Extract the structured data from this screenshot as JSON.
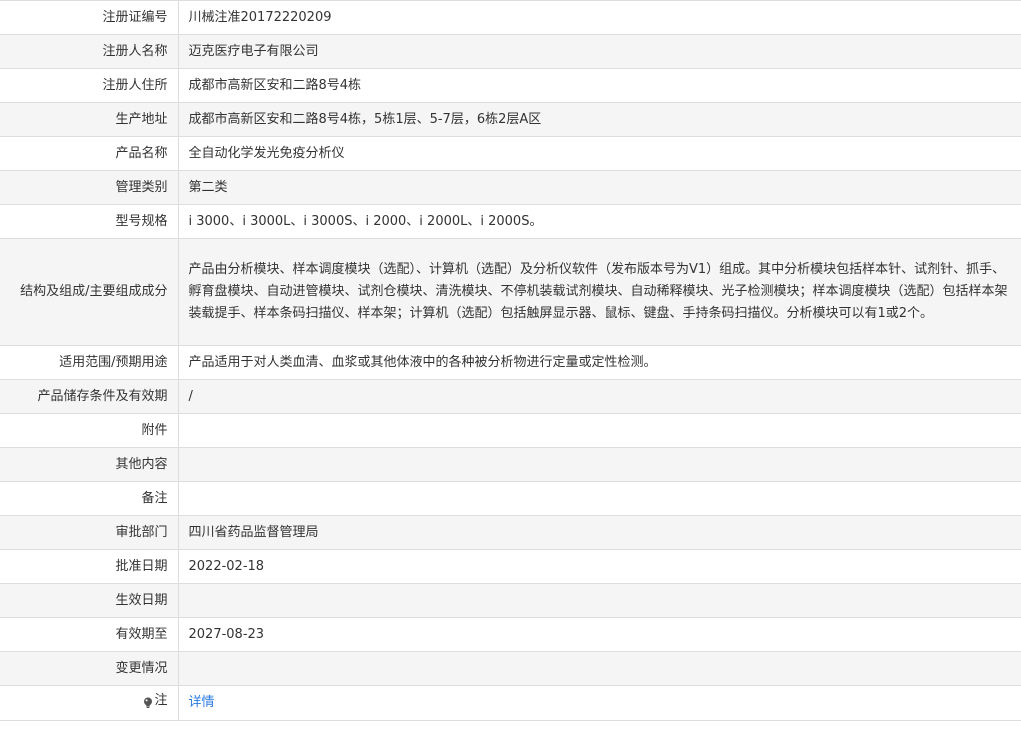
{
  "rows": [
    {
      "label": "注册证编号",
      "value": "川械注准20172220209"
    },
    {
      "label": "注册人名称",
      "value": "迈克医疗电子有限公司"
    },
    {
      "label": "注册人住所",
      "value": "成都市高新区安和二路8号4栋"
    },
    {
      "label": "生产地址",
      "value": "成都市高新区安和二路8号4栋，5栋1层、5-7层，6栋2层A区"
    },
    {
      "label": "产品名称",
      "value": "全自动化学发光免疫分析仪"
    },
    {
      "label": "管理类别",
      "value": "第二类"
    },
    {
      "label": "型号规格",
      "value": "i 3000、i 3000L、i 3000S、i 2000、i 2000L、i 2000S。"
    },
    {
      "label": "结构及组成/主要组成成分",
      "value": "产品由分析模块、样本调度模块（选配）、计算机（选配）及分析仪软件（发布版本号为V1）组成。其中分析模块包括样本针、试剂针、抓手、孵育盘模块、自动进管模块、试剂仓模块、清洗模块、不停机装载试剂模块、自动稀释模块、光子检测模块；样本调度模块（选配）包括样本架装载提手、样本条码扫描仪、样本架；计算机（选配）包括触屏显示器、鼠标、键盘、手持条码扫描仪。分析模块可以有1或2个。"
    },
    {
      "label": "适用范围/预期用途",
      "value": "产品适用于对人类血清、血浆或其他体液中的各种被分析物进行定量或定性检测。"
    },
    {
      "label": "产品储存条件及有效期",
      "value": "/"
    },
    {
      "label": "附件",
      "value": ""
    },
    {
      "label": "其他内容",
      "value": ""
    },
    {
      "label": "备注",
      "value": ""
    },
    {
      "label": "审批部门",
      "value": "四川省药品监督管理局"
    },
    {
      "label": "批准日期",
      "value": "2022-02-18"
    },
    {
      "label": "生效日期",
      "value": ""
    },
    {
      "label": "有效期至",
      "value": "2027-08-23"
    },
    {
      "label": "变更情况",
      "value": ""
    }
  ],
  "note": {
    "label": "注",
    "icon": "bulb-icon",
    "link_text": "详情",
    "link_color": "#2a7ae2"
  }
}
